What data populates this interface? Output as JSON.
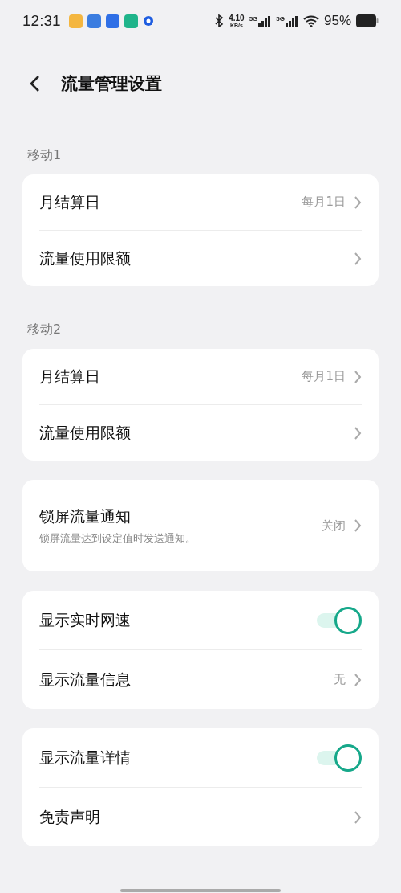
{
  "status_bar": {
    "time": "12:31",
    "speed": "4.10",
    "speed_unit": "KB/s",
    "sim1": "5G",
    "sim2": "5G",
    "battery": "95%"
  },
  "header": {
    "title": "流量管理设置"
  },
  "groups": [
    {
      "label": "移动1",
      "items": [
        {
          "kind": "link",
          "title": "月结算日",
          "value": "每月1日"
        },
        {
          "kind": "link",
          "title": "流量使用限额"
        }
      ]
    },
    {
      "label": "移动2",
      "items": [
        {
          "kind": "link",
          "title": "月结算日",
          "value": "每月1日"
        },
        {
          "kind": "link",
          "title": "流量使用限额"
        }
      ]
    },
    {
      "items": [
        {
          "kind": "link",
          "title": "锁屏流量通知",
          "subtitle": "锁屏流量达到设定值时发送通知。",
          "value": "关闭"
        }
      ]
    },
    {
      "items": [
        {
          "kind": "toggle",
          "title": "显示实时网速",
          "on": true
        },
        {
          "kind": "link",
          "title": "显示流量信息",
          "value": "无"
        }
      ]
    },
    {
      "items": [
        {
          "kind": "toggle",
          "title": "显示流量详情",
          "on": true
        },
        {
          "kind": "link",
          "title": "免责声明"
        }
      ]
    }
  ]
}
